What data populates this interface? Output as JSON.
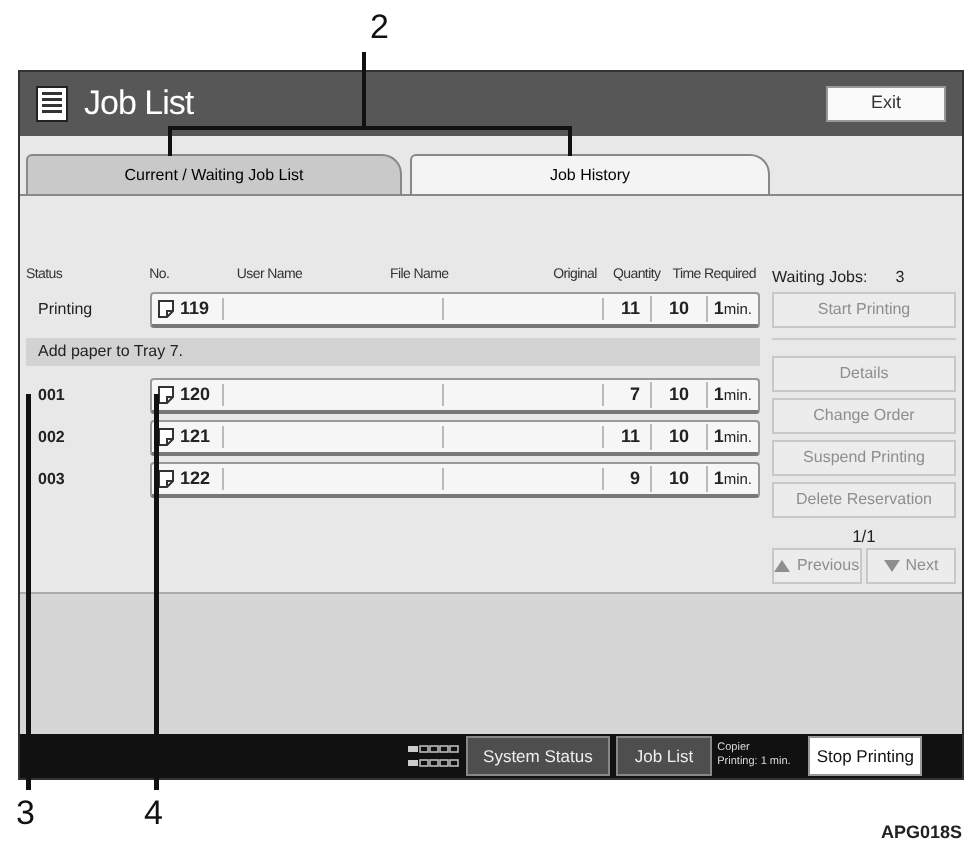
{
  "header": {
    "title": "Job List",
    "exit_button": "Exit"
  },
  "tabs": [
    {
      "label": "Current / Waiting Job List",
      "selected": true
    },
    {
      "label": "Job History",
      "selected": false
    }
  ],
  "columns": [
    "Status",
    "No.",
    "User Name",
    "File Name",
    "Original",
    "Quantity",
    "Time Required"
  ],
  "waiting_jobs": {
    "label": "Waiting Jobs:",
    "count": "3"
  },
  "current_job": {
    "status": "Printing",
    "number": "119",
    "originals": "11",
    "quantity": "10",
    "time": "1",
    "unit": "min."
  },
  "notice": "Add paper to Tray 7.",
  "waiting_list": [
    {
      "status": "001",
      "number": "120",
      "originals": "7",
      "quantity": "10",
      "time": "1",
      "unit": "min."
    },
    {
      "status": "002",
      "number": "121",
      "originals": "11",
      "quantity": "10",
      "time": "1",
      "unit": "min."
    },
    {
      "status": "003",
      "number": "122",
      "originals": "9",
      "quantity": "10",
      "time": "1",
      "unit": "min."
    }
  ],
  "start_button": {
    "label": "Start Printing",
    "disabled": true
  },
  "actions": [
    {
      "label": "Details",
      "disabled": true
    },
    {
      "label": "Change Order",
      "disabled": true
    },
    {
      "label": "Suspend Printing",
      "disabled": true
    },
    {
      "label": "Delete Reservation",
      "disabled": true
    }
  ],
  "page": "1/1",
  "pager": [
    {
      "label": "Previous",
      "kind": "up",
      "disabled": true
    },
    {
      "label": "Next",
      "kind": "down",
      "disabled": true
    }
  ],
  "status_bar": {
    "buttons": [
      "System Status",
      "Job List"
    ],
    "mode": "Copier",
    "progress": "Printing: 1 min.",
    "stop_button": "Stop Printing"
  },
  "callouts": [
    {
      "label": "2",
      "kind": "bracket"
    },
    {
      "label": "3",
      "kind": "line"
    },
    {
      "label": "4",
      "kind": "line"
    }
  ],
  "figure_code": "APG018S"
}
